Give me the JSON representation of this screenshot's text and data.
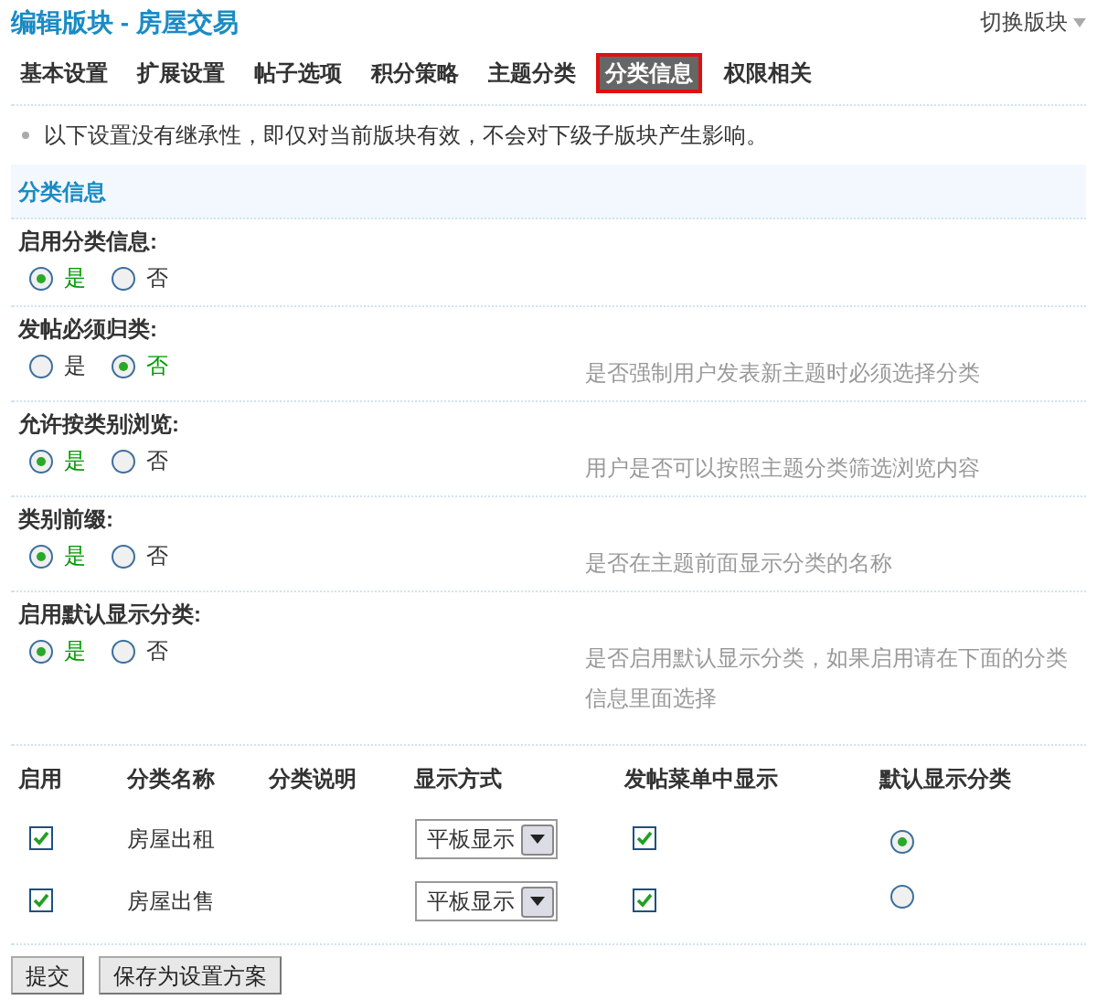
{
  "header": {
    "title": "编辑版块 - 房屋交易",
    "switch_label": "切换版块"
  },
  "tabs": [
    {
      "label": "基本设置",
      "selected": false
    },
    {
      "label": "扩展设置",
      "selected": false
    },
    {
      "label": "帖子选项",
      "selected": false
    },
    {
      "label": "积分策略",
      "selected": false
    },
    {
      "label": "主题分类",
      "selected": false
    },
    {
      "label": "分类信息",
      "selected": true
    },
    {
      "label": "权限相关",
      "selected": false
    }
  ],
  "notice": "以下设置没有继承性，即仅对当前版块有效，不会对下级子版块产生影响。",
  "section_title": "分类信息",
  "settings": [
    {
      "label": "启用分类信息:",
      "options": [
        {
          "label": "是",
          "selected": true
        },
        {
          "label": "否",
          "selected": false
        }
      ]
    },
    {
      "label": "发帖必须归类:",
      "options": [
        {
          "label": "是",
          "selected": false
        },
        {
          "label": "否",
          "selected": true
        }
      ],
      "description": "是否强制用户发表新主题时必须选择分类"
    },
    {
      "label": "允许按类别浏览:",
      "options": [
        {
          "label": "是",
          "selected": true
        },
        {
          "label": "否",
          "selected": false
        }
      ],
      "description": "用户是否可以按照主题分类筛选浏览内容"
    },
    {
      "label": "类别前缀:",
      "options": [
        {
          "label": "是",
          "selected": true
        },
        {
          "label": "否",
          "selected": false
        }
      ],
      "description": "是否在主题前面显示分类的名称"
    },
    {
      "label": "启用默认显示分类:",
      "options": [
        {
          "label": "是",
          "selected": true
        },
        {
          "label": "否",
          "selected": false
        }
      ],
      "description": "是否启用默认显示分类，如果启用请在下面的分类信息里面选择"
    }
  ],
  "table": {
    "columns": [
      "启用",
      "分类名称",
      "分类说明",
      "显示方式",
      "发帖菜单中显示",
      "默认显示分类"
    ],
    "rows": [
      {
        "enabled": true,
        "name": "房屋出租",
        "display_mode": "平板显示",
        "in_post_menu": true,
        "default": {
          "selected": true
        }
      },
      {
        "enabled": true,
        "name": "房屋出售",
        "display_mode": "平板显示",
        "in_post_menu": true,
        "default": {
          "selected": false
        }
      }
    ]
  },
  "buttons": [
    "提交",
    "保存为设置方案"
  ]
}
